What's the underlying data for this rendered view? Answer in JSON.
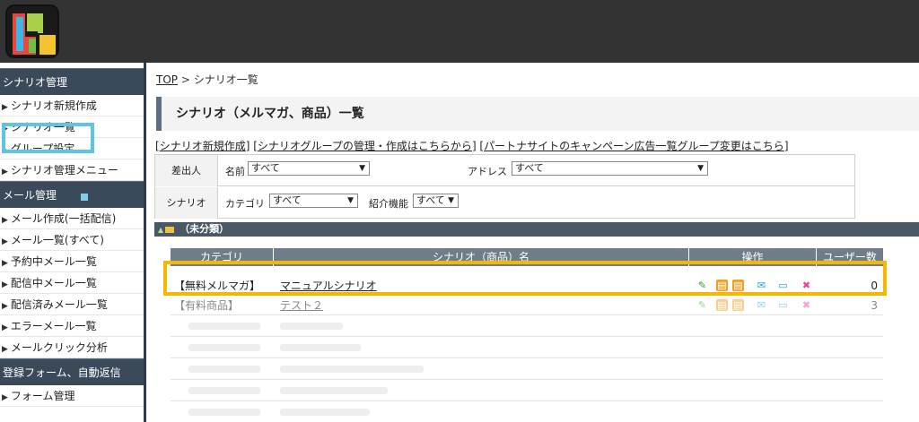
{
  "sidebar": {
    "sections": [
      {
        "title": "シナリオ管理",
        "items": [
          "シナリオ新規作成",
          "シナリオ一覧",
          "グループ設定",
          "シナリオ管理メニュー"
        ]
      },
      {
        "title": "メール管理",
        "items": [
          "メール作成(一括配信)",
          "メール一覧(すべて)",
          "予約中メール一覧",
          "配信中メール一覧",
          "配信済みメール一覧",
          "エラーメール一覧",
          "メールクリック分析"
        ]
      },
      {
        "title": "登録フォーム、自動返信",
        "items": [
          "フォーム管理"
        ]
      }
    ]
  },
  "breadcrumb": {
    "top": "TOP",
    "sep": " > ",
    "current": "シナリオ一覧"
  },
  "page_title": "シナリオ（メルマガ、商品）一覧",
  "links": {
    "l1": "シナリオ新規作成",
    "l2": "シナリオグループの管理・作成はこちらから",
    "l3": "パートナサイトのキャンペーン広告一覧グループ変更はこちら"
  },
  "filter": {
    "sender_label": "差出人",
    "name_label": "名前",
    "name_value": "すべて",
    "address_label": "アドレス",
    "address_value": "すべて",
    "scenario_label": "シナリオ",
    "category_label": "カテゴリ",
    "category_value": "すべて",
    "intro_label": "紹介機能",
    "intro_value": "すべて"
  },
  "section": {
    "title": "（未分類）"
  },
  "table": {
    "headers": [
      "カテゴリ",
      "シナリオ（商品）名",
      "操作",
      "ユーザー数"
    ],
    "rows": [
      {
        "category": "【無料メルマガ】",
        "name": "マニュアルシナリオ",
        "users": "0"
      },
      {
        "category": "【有料商品】",
        "name": "テスト２",
        "users": "3"
      }
    ]
  },
  "colors": {
    "highlight_yellow": "#f5b800",
    "highlight_blue": "#5fc3e4",
    "sidebar_header": "#3a4a5a",
    "table_header": "#6e7d8c"
  },
  "icons": [
    "edit-pencil-icon",
    "book-icon",
    "book-icon",
    "mail-icon",
    "monitor-icon",
    "delete-x-icon"
  ]
}
